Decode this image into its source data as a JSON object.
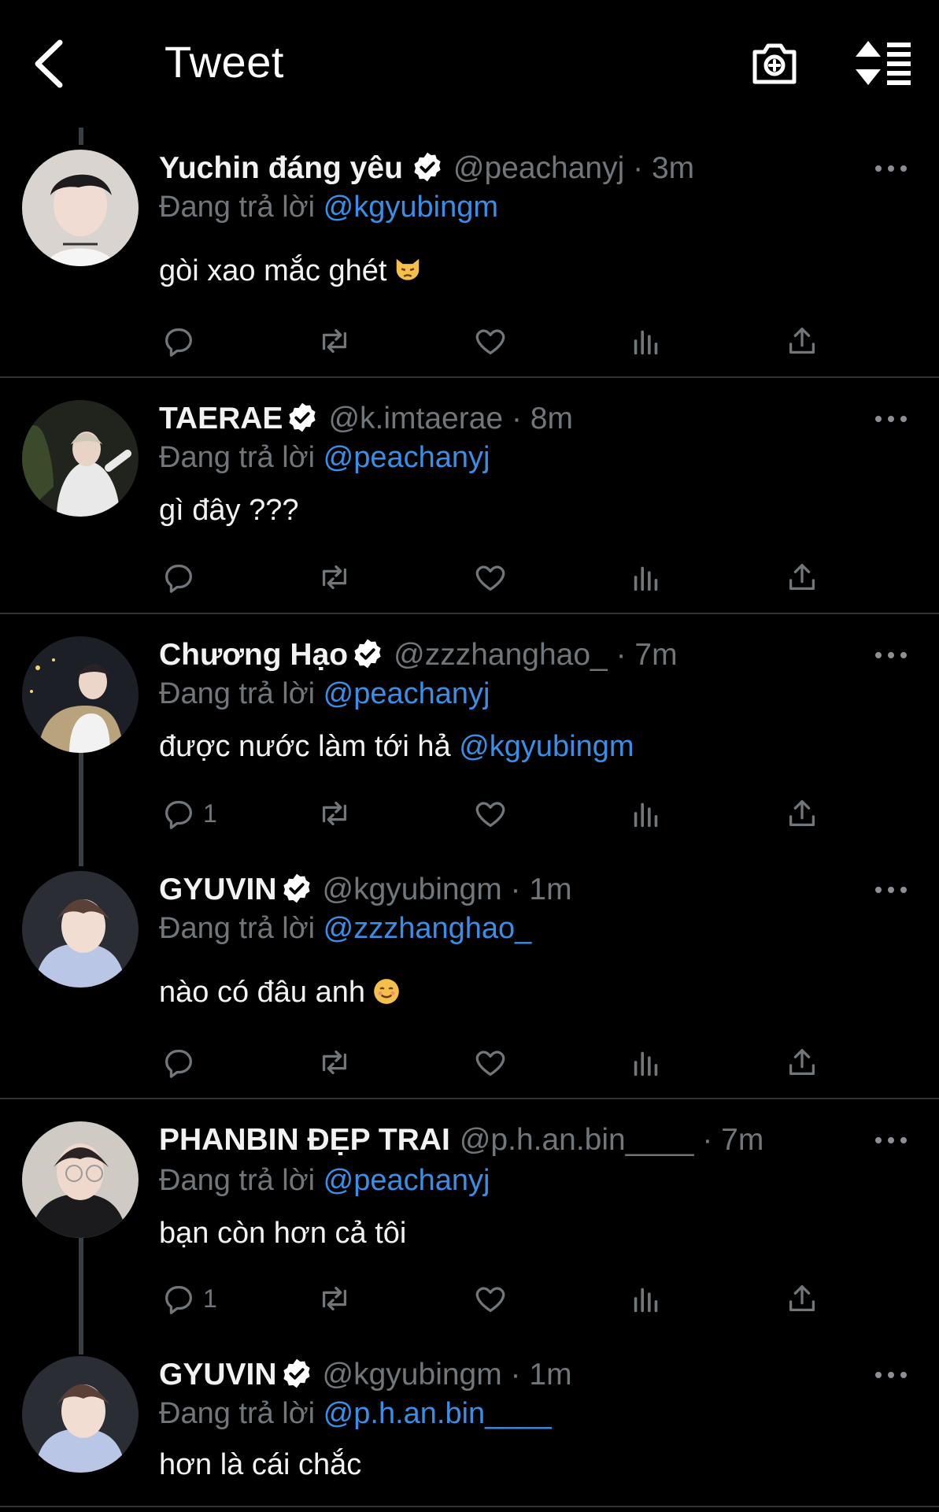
{
  "header": {
    "title": "Tweet",
    "back_icon": "chevron-left-icon",
    "camera_icon": "camera-add-icon",
    "sort_icon": "sort-icon"
  },
  "colors": {
    "background": "#000000",
    "mention": "#3b8ee6",
    "muted": "#71767b",
    "divider": "#2f3336"
  },
  "tweets": [
    {
      "name": "Yuchin đáng yêu",
      "handle_time": "@peachanyj · 3m",
      "reply_prefix": "Đang trả lời",
      "reply_to": "@kgyubingm",
      "text": "gòi xao mắc ghét",
      "emoji": "pouting-cat-emoji",
      "reply_count": ""
    },
    {
      "name": "TAERAE",
      "handle_time": "@k.imtaerae · 8m",
      "reply_prefix": "Đang trả lời",
      "reply_to": "@peachanyj",
      "text": "gì đây ???",
      "reply_count": ""
    },
    {
      "name": "Chương Hạo",
      "handle_time": "@zzzhanghao_ · 7m",
      "reply_prefix": "Đang trả lời",
      "reply_to": "@peachanyj",
      "text": "được nước làm tới hả",
      "text_mention": "@kgyubingm",
      "reply_count": "1"
    },
    {
      "name": "GYUVIN",
      "handle_time": "@kgyubingm · 1m",
      "reply_prefix": "Đang trả lời",
      "reply_to": "@zzzhanghao_",
      "text": "nào có đâu anh",
      "emoji": "smiling-face-emoji",
      "reply_count": ""
    },
    {
      "name": "PHANBIN ĐẸP TRAI",
      "handle_time": "@p.h.an.bin____ · 7m",
      "reply_prefix": "Đang trả lời",
      "reply_to": "@peachanyj",
      "text": "bạn còn hơn cả tôi",
      "reply_count": "1"
    },
    {
      "name": "GYUVIN",
      "handle_time": "@kgyubingm · 1m",
      "reply_prefix": "Đang trả lời",
      "reply_to": "@p.h.an.bin____",
      "text": "hơn là cái chắc"
    }
  ]
}
